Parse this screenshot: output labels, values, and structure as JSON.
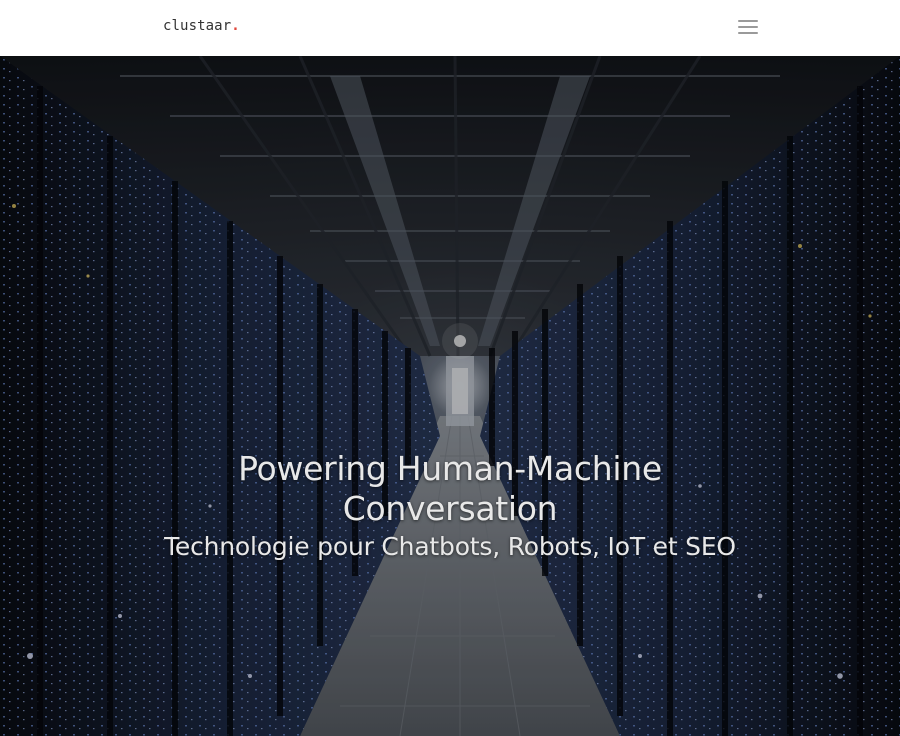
{
  "header": {
    "logo_text": "clustaar",
    "logo_dot": ".",
    "menu_icon": "hamburger-menu-icon",
    "background_color": "#ffffff",
    "logo_dot_color": "#e0473c"
  },
  "hero": {
    "background_image": "server-room-aisle",
    "title": "Powering Human-Machine Conversation",
    "subtitle": "Technologie pour Chatbots, Robots, IoT et SEO",
    "text_color": "#e8e8e8"
  }
}
